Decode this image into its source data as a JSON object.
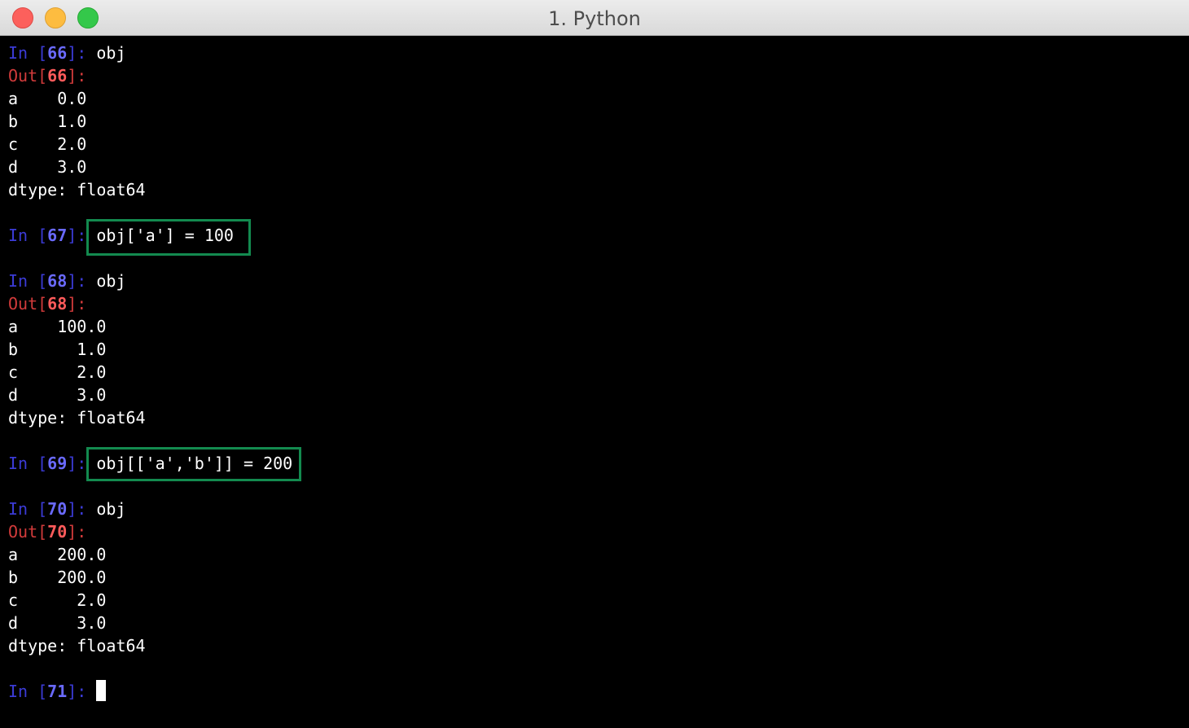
{
  "window": {
    "title": "1. Python"
  },
  "cells": [
    {
      "in_label": "In [",
      "in_num": "66",
      "in_suffix": "]: ",
      "input": "obj",
      "out_label": "Out[",
      "out_num": "66",
      "out_suffix": "]:",
      "output": [
        "a    0.0",
        "b    1.0",
        "c    2.0",
        "d    3.0",
        "dtype: float64"
      ]
    },
    {
      "in_label": "In [",
      "in_num": "67",
      "in_suffix": "]: ",
      "input": "obj['a'] = 100"
    },
    {
      "in_label": "In [",
      "in_num": "68",
      "in_suffix": "]: ",
      "input": "obj",
      "out_label": "Out[",
      "out_num": "68",
      "out_suffix": "]:",
      "output": [
        "a    100.0",
        "b      1.0",
        "c      2.0",
        "d      3.0",
        "dtype: float64"
      ]
    },
    {
      "in_label": "In [",
      "in_num": "69",
      "in_suffix": "]: ",
      "input": "obj[['a','b']] = 200"
    },
    {
      "in_label": "In [",
      "in_num": "70",
      "in_suffix": "]: ",
      "input": "obj",
      "out_label": "Out[",
      "out_num": "70",
      "out_suffix": "]:",
      "output": [
        "a    200.0",
        "b    200.0",
        "c      2.0",
        "d      3.0",
        "dtype: float64"
      ]
    },
    {
      "in_label": "In [",
      "in_num": "71",
      "in_suffix": "]: ",
      "input": ""
    }
  ],
  "colors": {
    "in_prompt": "#3b3bd6",
    "out_prompt": "#d23b3b",
    "highlight_box": "#138a4f",
    "background": "#000000",
    "text": "#ffffff"
  }
}
